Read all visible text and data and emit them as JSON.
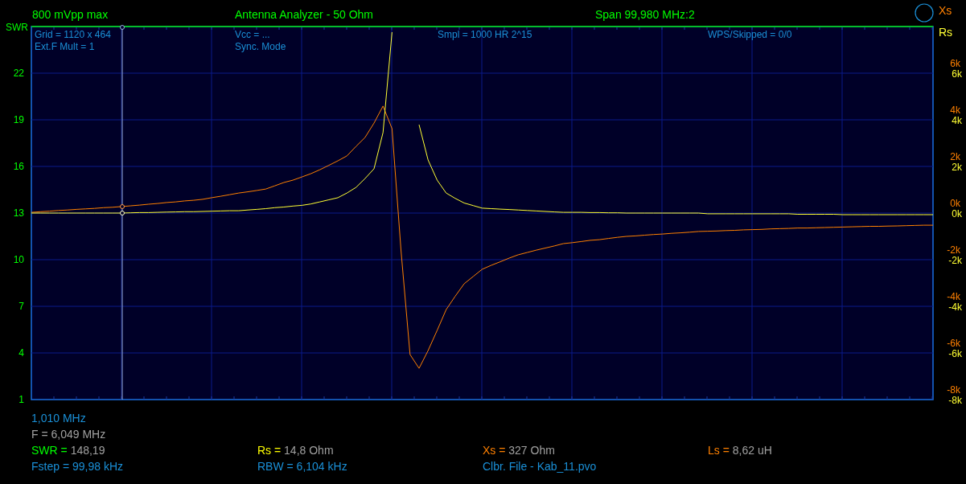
{
  "header": {
    "left": "800 mVpp max",
    "center": "Antenna Analyzer - 50 Ohm",
    "right": "Span 99,980 MHz:2"
  },
  "chart": {
    "left_axis": {
      "label": "SWR",
      "ticks": [
        "22",
        "19",
        "16",
        "13",
        "10",
        "7",
        "4",
        "1"
      ]
    },
    "xs_ticks": [
      "6k",
      "4k",
      "2k",
      "0k",
      "-2k",
      "-4k",
      "-6k",
      "-8k"
    ],
    "info_columns": [
      [
        "Grid = 1120 x 464",
        "Ext.F Mult = 1"
      ],
      [
        "Vcc = ...",
        "Sync. Mode"
      ],
      [
        "Smpl = 1000 HR 2^15"
      ],
      [
        "WPS/Skipped  = 0/0"
      ]
    ],
    "chart_data": {
      "type": "line",
      "categories": [
        null,
        null,
        null,
        null,
        null,
        null,
        null,
        null,
        null,
        null,
        null,
        null,
        null,
        null,
        null,
        null,
        null,
        null,
        null,
        null,
        null,
        null,
        null,
        null,
        null,
        null,
        null,
        null,
        null,
        null,
        null,
        null,
        null,
        null,
        null,
        null,
        null,
        null,
        null,
        null,
        null,
        null,
        null,
        null,
        null,
        null,
        null,
        null,
        null,
        null,
        null,
        null,
        null,
        null,
        null,
        null,
        null,
        null,
        null,
        null,
        null,
        null,
        null,
        null,
        null,
        null,
        null,
        null,
        null,
        null,
        null,
        null,
        null,
        null,
        null,
        null,
        null,
        null,
        null,
        null,
        null,
        null,
        null,
        null,
        null,
        null,
        null,
        null,
        null,
        null,
        null,
        null,
        null,
        null,
        null,
        null,
        null,
        null,
        null,
        null,
        null
      ],
      "ylim": [
        -8,
        8
      ],
      "grid": true,
      "yticks": [
        {
          "value": 6,
          "label": "6k"
        },
        {
          "value": 4,
          "label": "4k"
        },
        {
          "value": 2,
          "label": "2k"
        },
        {
          "value": 0,
          "label": "0k"
        },
        {
          "value": -2,
          "label": "-2k"
        },
        {
          "value": -4,
          "label": "-4k"
        },
        {
          "value": -6,
          "label": "-6k"
        },
        {
          "value": -8,
          "label": "-8k"
        }
      ],
      "series": [
        {
          "name": "Xs",
          "color": "#ff8000",
          "values": [
            0.03,
            0.06,
            0.08,
            0.11,
            0.13,
            0.16,
            0.18,
            0.2,
            0.23,
            0.25,
            0.28,
            0.31,
            0.34,
            0.38,
            0.41,
            0.45,
            0.48,
            0.52,
            0.55,
            0.59,
            0.66,
            0.72,
            0.79,
            0.86,
            0.91,
            0.97,
            1.03,
            1.17,
            1.31,
            1.41,
            1.55,
            1.69,
            1.86,
            2.05,
            2.24,
            2.45,
            2.86,
            3.24,
            3.86,
            4.59,
            3.62,
            -1.62,
            -6.07,
            -6.66,
            -5.9,
            -5.03,
            -4.14,
            -3.57,
            -3.03,
            -2.72,
            -2.41,
            -2.24,
            -2.09,
            -1.93,
            -1.79,
            -1.69,
            -1.59,
            -1.5,
            -1.41,
            -1.31,
            -1.27,
            -1.22,
            -1.17,
            -1.14,
            -1.09,
            -1.04,
            -1,
            -0.98,
            -0.95,
            -0.92,
            -0.9,
            -0.87,
            -0.85,
            -0.82,
            -0.79,
            -0.78,
            -0.77,
            -0.75,
            -0.74,
            -0.72,
            -0.71,
            -0.7,
            -0.68,
            -0.67,
            -0.66,
            -0.64,
            -0.64,
            -0.63,
            -0.62,
            -0.61,
            -0.6,
            -0.59,
            -0.58,
            -0.57,
            -0.57,
            -0.56,
            -0.55,
            -0.54,
            -0.53,
            -0.52,
            -0.52
          ]
        },
        {
          "name": "Rs",
          "color": "#ffff33",
          "values": [
            0,
            0,
            0,
            0,
            0,
            0,
            0,
            0,
            0,
            0,
            0,
            0.01,
            0.02,
            0.02,
            0.03,
            0.04,
            0.05,
            0.06,
            0.06,
            0.07,
            0.08,
            0.09,
            0.1,
            0.1,
            0.13,
            0.16,
            0.19,
            0.23,
            0.26,
            0.3,
            0.33,
            0.39,
            0.48,
            0.57,
            0.66,
            0.86,
            1.1,
            1.48,
            1.9,
            3.45,
            7.76,
            null,
            null,
            3.79,
            2.28,
            1.41,
            0.86,
            0.63,
            0.43,
            0.32,
            0.21,
            0.19,
            0.17,
            0.15,
            0.13,
            0.11,
            0.09,
            0.07,
            0.05,
            0.03,
            0.03,
            0.03,
            0.02,
            0.02,
            0.01,
            0.01,
            0,
            0,
            0,
            0,
            0,
            0,
            0,
            0,
            0,
            -0.03,
            -0.03,
            -0.03,
            -0.03,
            -0.03,
            -0.03,
            -0.03,
            -0.03,
            -0.03,
            -0.03,
            -0.05,
            -0.05,
            -0.05,
            -0.05,
            -0.05,
            -0.07,
            -0.07,
            -0.07,
            -0.07,
            -0.07,
            -0.07,
            -0.07,
            -0.07,
            -0.07,
            -0.07,
            -0.07
          ]
        }
      ]
    }
  },
  "start_frequency": "1,010 MHz",
  "cursor_frequency": "F = 6,049 MHz",
  "readings": [
    {
      "label": "SWR =",
      "value": "148,19",
      "color": "#00ff00"
    },
    {
      "label": "Rs =",
      "value": "14,8 Ohm",
      "color": "#ffff00"
    },
    {
      "label": "Xs =",
      "value": "327 Ohm",
      "color": "#ff8000"
    },
    {
      "label": "Ls =",
      "value": "8,62 uH",
      "color": "#ff8000"
    }
  ],
  "footer": [
    "Fstep = 99,98 kHz",
    "RBW = 6,104 kHz",
    "Clbr. File - Kab_11.pvo"
  ]
}
